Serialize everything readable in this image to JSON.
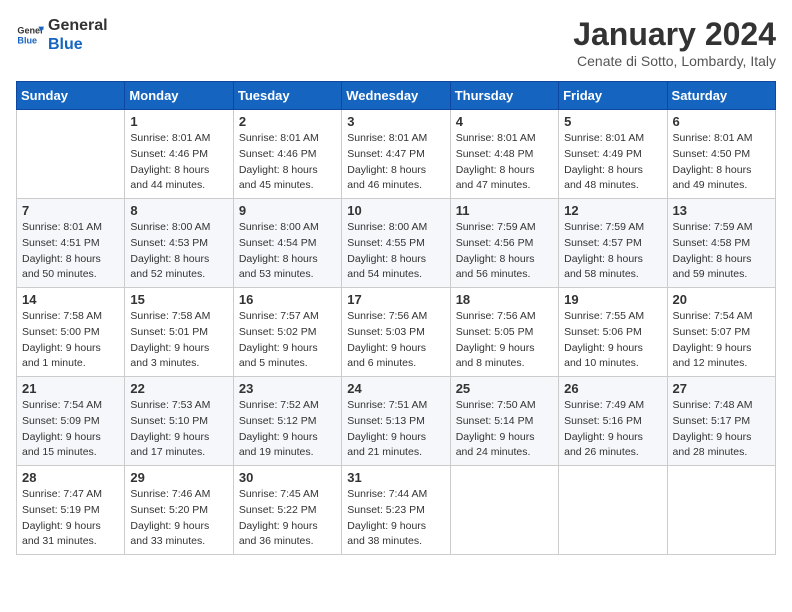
{
  "header": {
    "logo_line1": "General",
    "logo_line2": "Blue",
    "month": "January 2024",
    "location": "Cenate di Sotto, Lombardy, Italy"
  },
  "weekdays": [
    "Sunday",
    "Monday",
    "Tuesday",
    "Wednesday",
    "Thursday",
    "Friday",
    "Saturday"
  ],
  "weeks": [
    [
      {
        "day": "",
        "info": ""
      },
      {
        "day": "1",
        "info": "Sunrise: 8:01 AM\nSunset: 4:46 PM\nDaylight: 8 hours\nand 44 minutes."
      },
      {
        "day": "2",
        "info": "Sunrise: 8:01 AM\nSunset: 4:46 PM\nDaylight: 8 hours\nand 45 minutes."
      },
      {
        "day": "3",
        "info": "Sunrise: 8:01 AM\nSunset: 4:47 PM\nDaylight: 8 hours\nand 46 minutes."
      },
      {
        "day": "4",
        "info": "Sunrise: 8:01 AM\nSunset: 4:48 PM\nDaylight: 8 hours\nand 47 minutes."
      },
      {
        "day": "5",
        "info": "Sunrise: 8:01 AM\nSunset: 4:49 PM\nDaylight: 8 hours\nand 48 minutes."
      },
      {
        "day": "6",
        "info": "Sunrise: 8:01 AM\nSunset: 4:50 PM\nDaylight: 8 hours\nand 49 minutes."
      }
    ],
    [
      {
        "day": "7",
        "info": "Sunrise: 8:01 AM\nSunset: 4:51 PM\nDaylight: 8 hours\nand 50 minutes."
      },
      {
        "day": "8",
        "info": "Sunrise: 8:00 AM\nSunset: 4:53 PM\nDaylight: 8 hours\nand 52 minutes."
      },
      {
        "day": "9",
        "info": "Sunrise: 8:00 AM\nSunset: 4:54 PM\nDaylight: 8 hours\nand 53 minutes."
      },
      {
        "day": "10",
        "info": "Sunrise: 8:00 AM\nSunset: 4:55 PM\nDaylight: 8 hours\nand 54 minutes."
      },
      {
        "day": "11",
        "info": "Sunrise: 7:59 AM\nSunset: 4:56 PM\nDaylight: 8 hours\nand 56 minutes."
      },
      {
        "day": "12",
        "info": "Sunrise: 7:59 AM\nSunset: 4:57 PM\nDaylight: 8 hours\nand 58 minutes."
      },
      {
        "day": "13",
        "info": "Sunrise: 7:59 AM\nSunset: 4:58 PM\nDaylight: 8 hours\nand 59 minutes."
      }
    ],
    [
      {
        "day": "14",
        "info": "Sunrise: 7:58 AM\nSunset: 5:00 PM\nDaylight: 9 hours\nand 1 minute."
      },
      {
        "day": "15",
        "info": "Sunrise: 7:58 AM\nSunset: 5:01 PM\nDaylight: 9 hours\nand 3 minutes."
      },
      {
        "day": "16",
        "info": "Sunrise: 7:57 AM\nSunset: 5:02 PM\nDaylight: 9 hours\nand 5 minutes."
      },
      {
        "day": "17",
        "info": "Sunrise: 7:56 AM\nSunset: 5:03 PM\nDaylight: 9 hours\nand 6 minutes."
      },
      {
        "day": "18",
        "info": "Sunrise: 7:56 AM\nSunset: 5:05 PM\nDaylight: 9 hours\nand 8 minutes."
      },
      {
        "day": "19",
        "info": "Sunrise: 7:55 AM\nSunset: 5:06 PM\nDaylight: 9 hours\nand 10 minutes."
      },
      {
        "day": "20",
        "info": "Sunrise: 7:54 AM\nSunset: 5:07 PM\nDaylight: 9 hours\nand 12 minutes."
      }
    ],
    [
      {
        "day": "21",
        "info": "Sunrise: 7:54 AM\nSunset: 5:09 PM\nDaylight: 9 hours\nand 15 minutes."
      },
      {
        "day": "22",
        "info": "Sunrise: 7:53 AM\nSunset: 5:10 PM\nDaylight: 9 hours\nand 17 minutes."
      },
      {
        "day": "23",
        "info": "Sunrise: 7:52 AM\nSunset: 5:12 PM\nDaylight: 9 hours\nand 19 minutes."
      },
      {
        "day": "24",
        "info": "Sunrise: 7:51 AM\nSunset: 5:13 PM\nDaylight: 9 hours\nand 21 minutes."
      },
      {
        "day": "25",
        "info": "Sunrise: 7:50 AM\nSunset: 5:14 PM\nDaylight: 9 hours\nand 24 minutes."
      },
      {
        "day": "26",
        "info": "Sunrise: 7:49 AM\nSunset: 5:16 PM\nDaylight: 9 hours\nand 26 minutes."
      },
      {
        "day": "27",
        "info": "Sunrise: 7:48 AM\nSunset: 5:17 PM\nDaylight: 9 hours\nand 28 minutes."
      }
    ],
    [
      {
        "day": "28",
        "info": "Sunrise: 7:47 AM\nSunset: 5:19 PM\nDaylight: 9 hours\nand 31 minutes."
      },
      {
        "day": "29",
        "info": "Sunrise: 7:46 AM\nSunset: 5:20 PM\nDaylight: 9 hours\nand 33 minutes."
      },
      {
        "day": "30",
        "info": "Sunrise: 7:45 AM\nSunset: 5:22 PM\nDaylight: 9 hours\nand 36 minutes."
      },
      {
        "day": "31",
        "info": "Sunrise: 7:44 AM\nSunset: 5:23 PM\nDaylight: 9 hours\nand 38 minutes."
      },
      {
        "day": "",
        "info": ""
      },
      {
        "day": "",
        "info": ""
      },
      {
        "day": "",
        "info": ""
      }
    ]
  ]
}
